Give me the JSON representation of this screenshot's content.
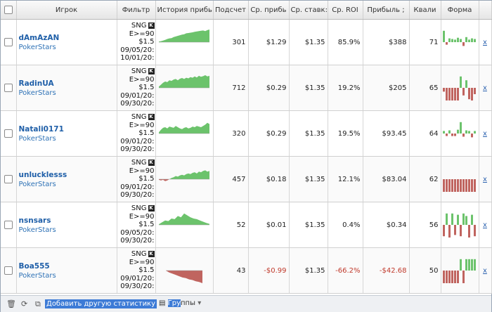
{
  "headers": {
    "player": "Игрок",
    "filter": "Фильтр",
    "history": "История прибь",
    "count": "Подсчет",
    "avg_profit": "Ср. прибь",
    "avg_stake": "Ср. ставк:",
    "avg_roi": "Ср. ROI",
    "profit": "Прибыль ;",
    "qual": "Квали",
    "form": "Форма"
  },
  "rows": [
    {
      "name": "dAmAzAN",
      "site": "PokerStars",
      "filter": {
        "game": "SNG",
        "badge": "K",
        "cond": "E>=90",
        "buyin": "$1.5",
        "date_from": "09/05/20:",
        "date_to": "10/01/20:"
      },
      "count": "301",
      "avg_profit": "$1.29",
      "avg_stake": "$1.35",
      "avg_roi": "85.9%",
      "profit": "$388",
      "qual": "71",
      "history": [
        0.05,
        0.08,
        0.12,
        0.18,
        0.25,
        0.3,
        0.32,
        0.4,
        0.45,
        0.5,
        0.55,
        0.6,
        0.62,
        0.7,
        0.72,
        0.75,
        0.78,
        0.82,
        0.85,
        0.88,
        0.9,
        0.92,
        0.88,
        0.95,
        1.0
      ],
      "form": [
        0.9,
        -0.2,
        0.3,
        0.25,
        0.2,
        0.35,
        0.25,
        -0.3,
        0.4,
        0.2,
        0.3,
        0.25
      ],
      "remove": "x"
    },
    {
      "name": "RadinUA",
      "site": "PokerStars",
      "filter": {
        "game": "SNG",
        "badge": "K",
        "cond": "E>=90",
        "buyin": "$1.5",
        "date_from": "09/01/20:",
        "date_to": "09/30/20:"
      },
      "count": "712",
      "avg_profit": "$0.29",
      "avg_stake": "$1.35",
      "avg_roi": "19.2%",
      "profit": "$205",
      "qual": "65",
      "history": [
        0.1,
        0.25,
        0.4,
        0.5,
        0.45,
        0.6,
        0.55,
        0.65,
        0.7,
        0.6,
        0.72,
        0.78,
        0.7,
        0.8,
        0.75,
        0.85,
        0.8,
        0.9,
        0.82,
        0.95,
        0.88,
        0.92,
        1.0,
        0.9,
        0.95
      ],
      "form": [
        -0.3,
        -1.0,
        -1.0,
        -1.0,
        -1.0,
        -1.0,
        0.9,
        -0.6,
        0.6,
        -0.9,
        -1.0,
        -0.5
      ],
      "remove": "x"
    },
    {
      "name": "Natali0171",
      "site": "PokerStars",
      "filter": {
        "game": "SNG",
        "badge": "K",
        "cond": "E>=90",
        "buyin": "$1.5",
        "date_from": "09/01/20:",
        "date_to": "09/30/20:"
      },
      "count": "320",
      "avg_profit": "$0.29",
      "avg_stake": "$1.35",
      "avg_roi": "19.5%",
      "profit": "$93.45",
      "qual": "64",
      "history": [
        0.1,
        0.3,
        0.45,
        0.5,
        0.4,
        0.55,
        0.5,
        0.45,
        0.6,
        0.5,
        0.4,
        0.35,
        0.45,
        0.5,
        0.4,
        0.45,
        0.55,
        0.5,
        0.6,
        0.55,
        0.5,
        0.6,
        0.7,
        0.85,
        0.75
      ],
      "form": [
        0.2,
        -0.2,
        0.25,
        -0.2,
        -0.2,
        0.3,
        0.9,
        -0.25,
        0.25,
        0.2,
        -0.3,
        0.2
      ],
      "remove": "x"
    },
    {
      "name": "unlucklesss",
      "site": "PokerStars",
      "filter": {
        "game": "SNG",
        "badge": "K",
        "cond": "E>=90",
        "buyin": "$1.5",
        "date_from": "09/01/20:",
        "date_to": "09/30/20:"
      },
      "count": "457",
      "avg_profit": "$0.18",
      "avg_stake": "$1.35",
      "avg_roi": "12.1%",
      "profit": "$83.04",
      "qual": "62",
      "history": [
        -0.05,
        -0.1,
        -0.05,
        -0.15,
        -0.1,
        0.0,
        0.1,
        0.15,
        0.25,
        0.2,
        0.3,
        0.35,
        0.3,
        0.4,
        0.45,
        0.4,
        0.5,
        0.55,
        0.45,
        0.6,
        0.55,
        0.65,
        0.7,
        0.6,
        0.65
      ],
      "form": [
        -1.0,
        -1.0,
        -1.0,
        -1.0,
        -1.0,
        -1.0,
        -1.0,
        -1.0,
        -1.0,
        -1.0,
        -1.0,
        -1.0
      ],
      "remove": "x"
    },
    {
      "name": "nsnsars",
      "site": "PokerStars",
      "filter": {
        "game": "SNG",
        "badge": "K",
        "cond": "E>=90",
        "buyin": "$1.5",
        "date_from": "09/05/20:",
        "date_to": "09/30/20:"
      },
      "count": "52",
      "avg_profit": "$0.01",
      "avg_stake": "$1.35",
      "avg_roi": "0.4%",
      "profit": "$0.34",
      "qual": "56",
      "history": [
        0.05,
        0.2,
        0.35,
        0.3,
        0.5,
        0.45,
        0.7,
        0.6,
        0.9,
        0.75,
        0.6,
        0.5,
        0.45,
        0.35,
        0.25,
        0.15,
        0.08
      ],
      "form": [
        -0.9,
        0.9,
        -1.0,
        0.9,
        -0.8,
        0.8,
        -0.9,
        0.9,
        0.7,
        -1.0,
        0.8,
        -0.9
      ],
      "remove": "x"
    },
    {
      "name": "Boa555",
      "site": "PokerStars",
      "filter": {
        "game": "SNG",
        "badge": "K",
        "cond": "E>=90",
        "buyin": "$1.5",
        "date_from": "09/01/20:",
        "date_to": "09/30/20:"
      },
      "count": "43",
      "avg_profit": "-$0.99",
      "avg_stake": "$1.35",
      "avg_roi": "-66.2%",
      "profit": "-$42.68",
      "qual": "50",
      "history": [
        0.0,
        -0.15,
        -0.25,
        -0.35,
        -0.45,
        -0.55,
        -0.6,
        -0.7,
        -0.75,
        -0.85,
        -0.9,
        -1.0
      ],
      "form": [
        -1.0,
        -1.0,
        -1.0,
        -1.0,
        -1.0,
        -1.0,
        0.9,
        -1.0,
        0.9,
        0.9,
        0.9,
        0.9
      ],
      "remove": "x"
    }
  ],
  "footer": {
    "add_stats": "Добавить другую статистику",
    "groups_hl": "Гру",
    "groups_rest": "ппы"
  },
  "colors": {
    "pos": "#6cc36c",
    "neg": "#c0645f",
    "accent": "#3d7bd6"
  }
}
